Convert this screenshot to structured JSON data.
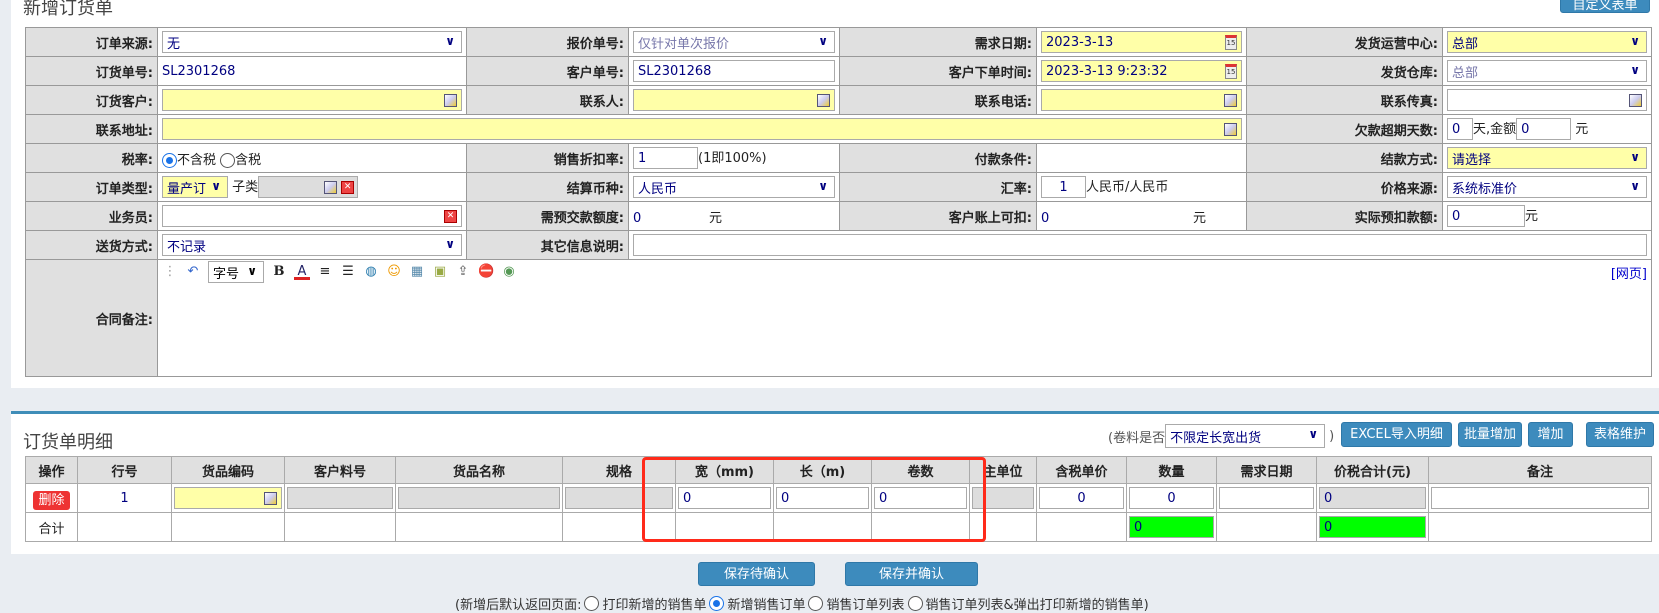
{
  "page": {
    "title": "新增订货单",
    "custom_form_button": "自定义表单"
  },
  "form": {
    "order_source": {
      "label": "订单来源:",
      "value": "无"
    },
    "quote_no": {
      "label": "报价单号:",
      "value": "仅针对单次报价"
    },
    "demand_date": {
      "label": "需求日期:",
      "value": "2023-3-13"
    },
    "ship_center": {
      "label": "发货运营中心:",
      "value": "总部"
    },
    "order_no": {
      "label": "订货单号:",
      "value": "SL2301268"
    },
    "customer_no": {
      "label": "客户单号:",
      "value": "SL2301268"
    },
    "order_time": {
      "label": "客户下单时间:",
      "value": "2023-3-13 9:23:32"
    },
    "warehouse": {
      "label": "发货仓库:",
      "value": "总部"
    },
    "customer": {
      "label": "订货客户:",
      "value": ""
    },
    "contact": {
      "label": "联系人:",
      "value": ""
    },
    "phone": {
      "label": "联系电话:",
      "value": ""
    },
    "fax": {
      "label": "联系传真:",
      "value": ""
    },
    "address": {
      "label": "联系地址:",
      "value": ""
    },
    "overdue": {
      "label": "欠款超期天数:",
      "days": "0",
      "mid": "天,金额",
      "amount": "0",
      "unit": "元"
    },
    "tax": {
      "label": "税率:",
      "opt1": "不含税",
      "opt2": "含税",
      "selected": "不含税"
    },
    "discount": {
      "label": "销售折扣率:",
      "value": "1",
      "note": "(1即100%)"
    },
    "payment_terms": {
      "label": "付款条件:",
      "value": ""
    },
    "settle_method": {
      "label": "结款方式:",
      "value": "请选择"
    },
    "order_type": {
      "label": "订单类型:",
      "value": "量产订",
      "sub_label": "子类",
      "sub_value": ""
    },
    "currency": {
      "label": "结算币种:",
      "value": "人民币"
    },
    "rate": {
      "label": "汇率:",
      "value": "1",
      "unit": "人民币/人民币"
    },
    "price_source": {
      "label": "价格来源:",
      "value": "系统标准价"
    },
    "salesman": {
      "label": "业务员:",
      "value": ""
    },
    "prepay": {
      "label": "需预交款额度:",
      "value": "0",
      "unit": "元"
    },
    "deductible": {
      "label": "客户账上可扣:",
      "value": "0",
      "unit": "元"
    },
    "actual_deduct": {
      "label": "实际预扣款额:",
      "value": "0",
      "unit": "元"
    },
    "delivery": {
      "label": "送货方式:",
      "value": "不记录"
    },
    "other_info": {
      "label": "其它信息说明:",
      "value": ""
    },
    "remark": {
      "label": "合同备注:",
      "font_size_select": "字号",
      "web_link": "[网页]"
    }
  },
  "detail": {
    "title": "订货单明细",
    "roll_label": "(卷料是否",
    "roll_value": "不限定长宽出货",
    "roll_close": ")",
    "buttons": {
      "excel": "EXCEL导入明细",
      "batch": "批量增加",
      "add": "增加",
      "table": "表格维护"
    },
    "columns": [
      "操作",
      "行号",
      "货品编码",
      "客户料号",
      "货品名称",
      "规格",
      "宽（mm)",
      "长（m)",
      "卷数",
      "主单位",
      "含税单价",
      "数量",
      "需求日期",
      "价税合计(元)",
      "备注"
    ],
    "row": {
      "delete": "删除",
      "line": "1",
      "width": "0",
      "length": "0",
      "rolls": "0",
      "price": "0",
      "qty": "0",
      "total": "0"
    },
    "sum": {
      "label": "合计",
      "qty": "0",
      "total": "0"
    },
    "highlight_color": "#ff2a1a"
  },
  "footer": {
    "save_pending": "保存待确认",
    "save_confirm": "保存并确认",
    "return_label": "(新增后默认返回页面:",
    "options": [
      "打印新增的销售单",
      "新增销售订单",
      "销售订单列表",
      "销售订单列表&弹出打印新增的销售单)"
    ],
    "selected": "新增销售订单"
  }
}
